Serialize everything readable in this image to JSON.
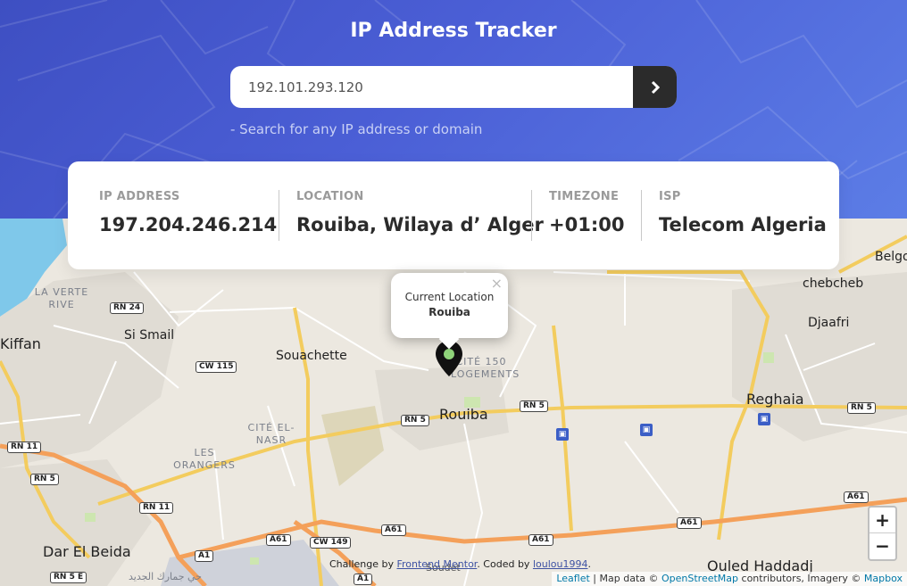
{
  "header": {
    "title": "IP Address Tracker",
    "search_value": "192.101.293.120",
    "hint": "- Search for any IP address or domain",
    "submit_icon": "chevron-right-icon"
  },
  "info": {
    "ip_label": "IP ADDRESS",
    "ip_value": "197.204.246.214",
    "location_label": "LOCATION",
    "location_value": "Rouiba, Wilaya d’ Alger",
    "timezone_label": "TIMEZONE",
    "timezone_value": "+01:00",
    "isp_label": "ISP",
    "isp_value": "Telecom Algeria"
  },
  "popup": {
    "title": "Current Location",
    "place": "Rouiba",
    "close": "×"
  },
  "map": {
    "places": {
      "belgo": "Belgo",
      "chebcheb": "chebcheb",
      "djaafri": "Djaafri",
      "reghaia": "Reghaia",
      "kiffan": "Kiffan",
      "si_smail": "Si Smail",
      "souachette": "Souachette",
      "rouiba": "Rouiba",
      "dar_el_beida": "Dar El Beida",
      "ouled_haddadj": "Ouled Haddadj",
      "la_verte": "LA VERTE",
      "rive": "RIVE",
      "cite150": "CITÉ 150",
      "logements": "LOGEMENTS",
      "cite_el": "CITÉ EL-",
      "nasr": "NASR",
      "les": "LES",
      "orangers": "ORANGERS",
      "arabic": "حي جمارك الجديد"
    },
    "roads": {
      "rn24": "RN 24",
      "cw115": "CW 115",
      "rn5_a": "RN 5",
      "rn5_b": "RN 5",
      "rn5_c": "RN 5",
      "rn5_d": "RN 5",
      "rn11_a": "RN 11",
      "rn11_b": "RN 11",
      "rn5e": "RN 5 E",
      "a61_a": "A61",
      "a61_b": "A61",
      "a61_c": "A61",
      "a61_d": "A61",
      "a61_e": "A61",
      "cw149": "CW 149",
      "a1_a": "A1",
      "a1_b": "A1",
      "soudet": "Soudet"
    },
    "zoom_in": "+",
    "zoom_out": "−"
  },
  "credit": {
    "prefix": "Challenge by ",
    "challenge_link": "Frontend Mentor",
    "middle": ". Coded by ",
    "author_link": "loulou1994",
    "suffix": "."
  },
  "attribution": {
    "leaflet": "Leaflet",
    "sep1": " | Map data © ",
    "osm": "OpenStreetMap",
    "middle": " contributors, Imagery © ",
    "mapbox": "Mapbox"
  }
}
